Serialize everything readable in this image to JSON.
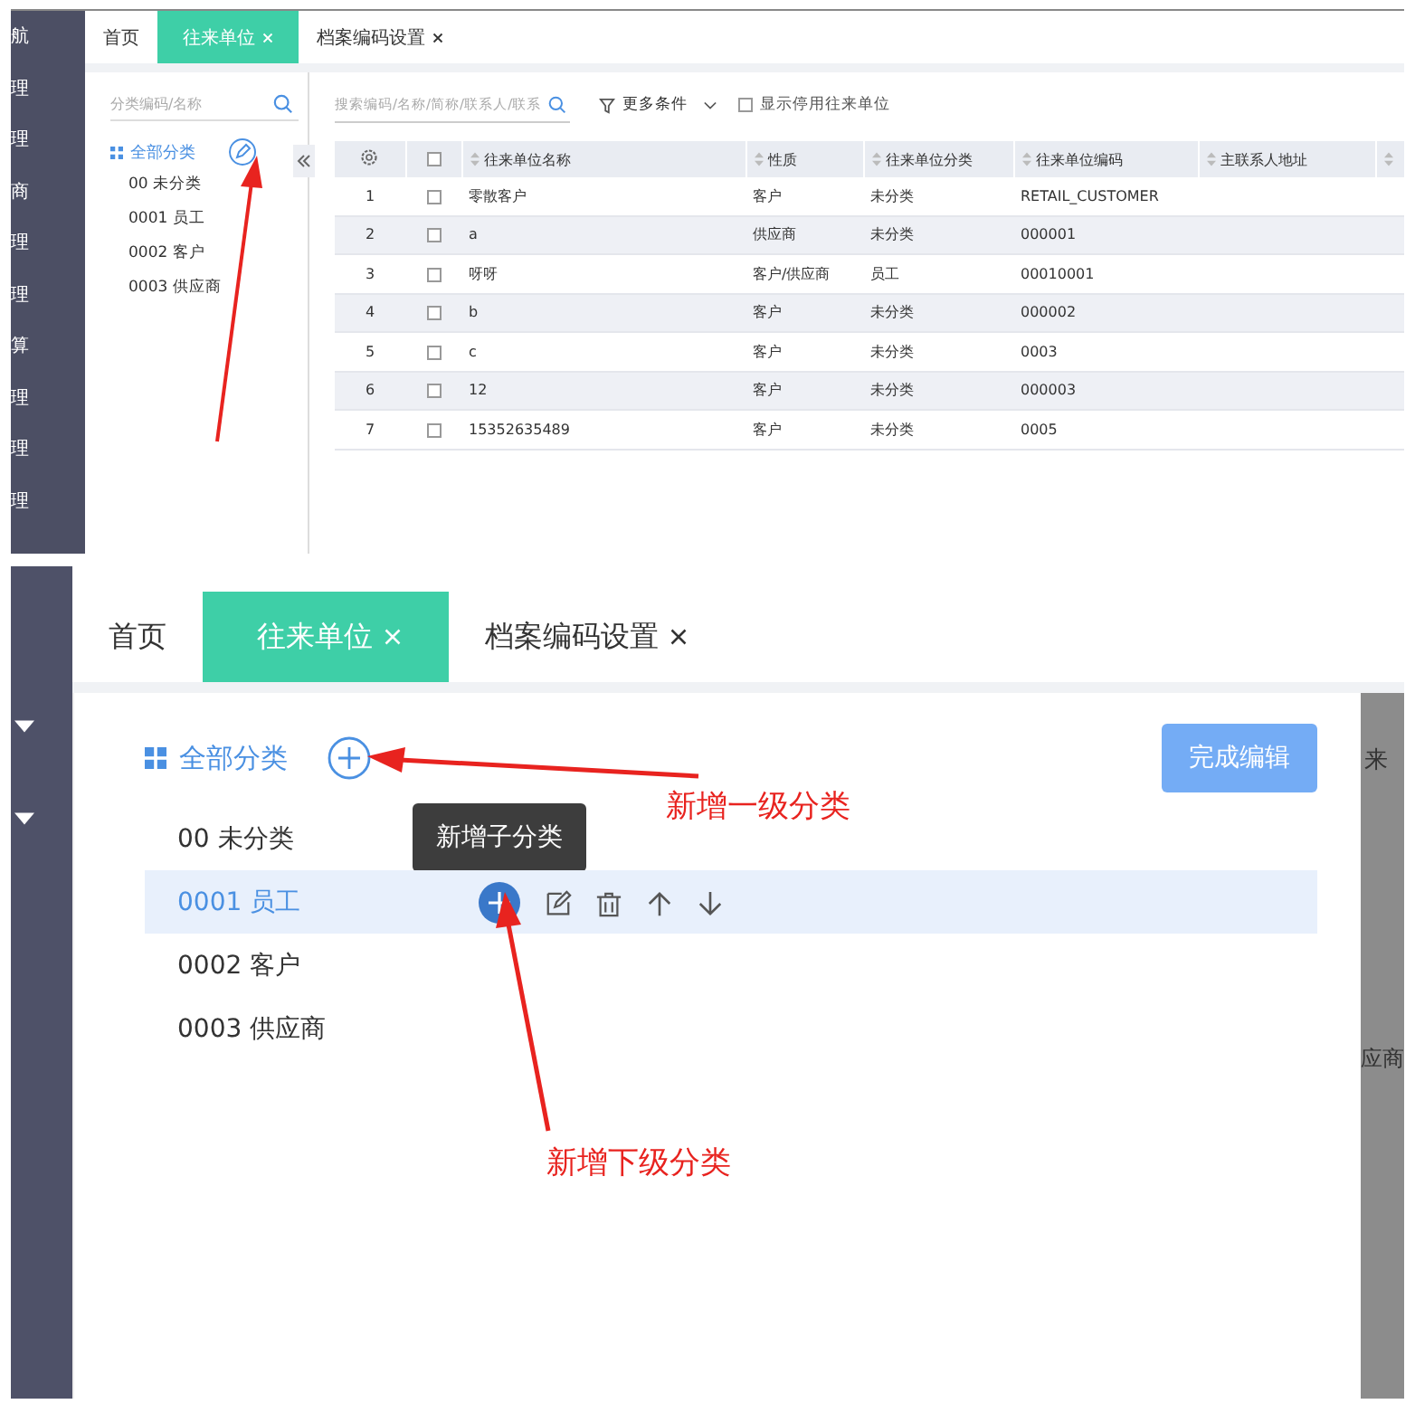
{
  "top_screenshot": {
    "sidebar_items": [
      "航",
      "理",
      "理",
      "商",
      "理",
      "理",
      "算",
      "理",
      "理",
      "理"
    ],
    "tabs": [
      {
        "label": "首页",
        "closable": false,
        "selected": false
      },
      {
        "label": "往来单位",
        "closable": true,
        "selected": true
      },
      {
        "label": "档案编码设置",
        "closable": true,
        "selected": false
      }
    ],
    "category_search": {
      "placeholder": "分类编码/名称"
    },
    "tree_root": "全部分类",
    "tree_items": [
      "00 未分类",
      "0001 员工",
      "0002 客户",
      "0003 供应商"
    ],
    "search": {
      "placeholder": "搜索编码/名称/简称/联系人/联系"
    },
    "more_filters": "更多条件",
    "show_disabled": {
      "label": "显示停用往来单位",
      "checked": false
    },
    "table": {
      "all_checked": false,
      "columns": [
        "往来单位名称",
        "性质",
        "往来单位分类",
        "往来单位编码",
        "主联系人地址"
      ],
      "rows": [
        {
          "index": "1",
          "checked": false,
          "cells": [
            "零散客户",
            "客户",
            "未分类",
            "RETAIL_CUSTOMER",
            ""
          ]
        },
        {
          "index": "2",
          "checked": false,
          "cells": [
            "a",
            "供应商",
            "未分类",
            "000001",
            ""
          ]
        },
        {
          "index": "3",
          "checked": false,
          "cells": [
            "呀呀",
            "客户/供应商",
            "员工",
            "00010001",
            ""
          ]
        },
        {
          "index": "4",
          "checked": false,
          "cells": [
            "b",
            "客户",
            "未分类",
            "000002",
            ""
          ]
        },
        {
          "index": "5",
          "checked": false,
          "cells": [
            "c",
            "客户",
            "未分类",
            "0003",
            ""
          ]
        },
        {
          "index": "6",
          "checked": false,
          "cells": [
            "12",
            "客户",
            "未分类",
            "000003",
            ""
          ]
        },
        {
          "index": "7",
          "checked": false,
          "cells": [
            "15352635489",
            "客户",
            "未分类",
            "0005",
            ""
          ]
        }
      ]
    }
  },
  "bottom_screenshot": {
    "tabs": [
      {
        "label": "首页",
        "closable": false,
        "selected": false
      },
      {
        "label": "往来单位",
        "closable": true,
        "selected": true
      },
      {
        "label": "档案编码设置",
        "closable": true,
        "selected": false
      }
    ],
    "tree_root": "全部分类",
    "finish_button": "完成编辑",
    "tooltip": "新增子分类",
    "tree_items": [
      {
        "label": "00 未分类",
        "selected": false
      },
      {
        "label": "0001 员工",
        "selected": true
      },
      {
        "label": "0002 客户",
        "selected": false
      },
      {
        "label": "0003 供应商",
        "selected": false
      }
    ],
    "background_texts": [
      "来",
      "应商"
    ],
    "annotations": [
      {
        "text": "新增一级分类"
      },
      {
        "text": "新增下级分类"
      }
    ]
  }
}
